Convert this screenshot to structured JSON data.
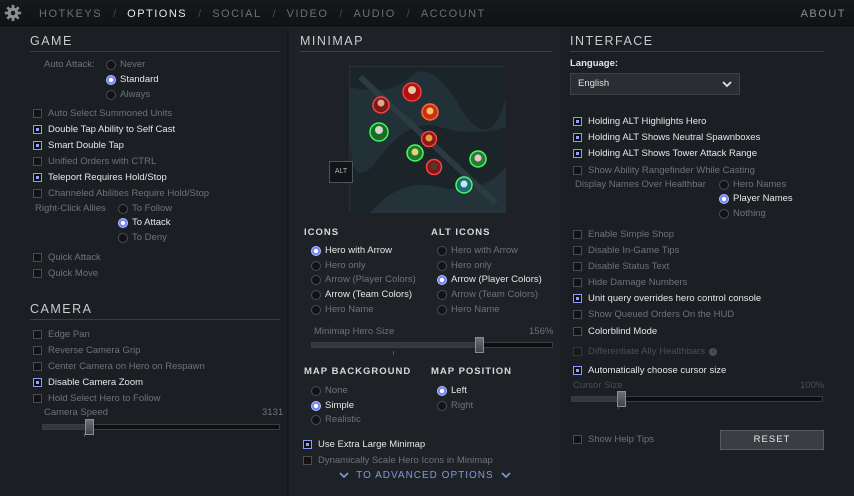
{
  "nav": {
    "tabs": [
      "HOTKEYS",
      "OPTIONS",
      "SOCIAL",
      "VIDEO",
      "AUDIO",
      "ACCOUNT"
    ],
    "active": "OPTIONS",
    "about": "ABOUT"
  },
  "game": {
    "title": "GAME",
    "auto_attack_label": "Auto Attack:",
    "auto_attack_options": [
      "Never",
      "Standard",
      "Always"
    ],
    "auto_attack_selected": "Standard",
    "checkboxes": [
      {
        "label": "Auto Select Summoned Units",
        "checked": false
      },
      {
        "label": "Double Tap Ability to Self Cast",
        "checked": true
      },
      {
        "label": "Smart Double Tap",
        "checked": true
      },
      {
        "label": "Unified Orders with CTRL",
        "checked": false
      },
      {
        "label": "Teleport Requires Hold/Stop",
        "checked": true
      },
      {
        "label": "Channeled Abilities Require Hold/Stop",
        "checked": false
      }
    ],
    "right_click_label": "Right-Click Allies",
    "right_click_options": [
      "To Follow",
      "To Attack",
      "To Deny"
    ],
    "right_click_selected": "To Attack",
    "quick_attack": "Quick Attack",
    "quick_move": "Quick Move"
  },
  "camera": {
    "title": "CAMERA",
    "checkboxes": [
      {
        "label": "Edge Pan",
        "checked": false
      },
      {
        "label": "Reverse Camera Grip",
        "checked": false
      },
      {
        "label": "Center Camera on Hero on Respawn",
        "checked": false
      },
      {
        "label": "Disable Camera Zoom",
        "checked": true
      },
      {
        "label": "Hold Select Hero to Follow",
        "checked": false
      }
    ],
    "speed_label": "Camera Speed",
    "speed_value": "3131",
    "speed_fraction": 0.2
  },
  "minimap": {
    "title": "MINIMAP",
    "alt_key": "ALT",
    "icons_title": "ICONS",
    "icons_options": [
      "Hero with Arrow",
      "Hero only",
      "Arrow (Player Colors)",
      "Arrow (Team Colors)",
      "Hero Name"
    ],
    "icons_selected": "Hero with Arrow",
    "alt_icons_title": "ALT ICONS",
    "alt_icons_options": [
      "Hero with Arrow",
      "Hero only",
      "Arrow (Player Colors)",
      "Arrow (Team Colors)",
      "Hero Name"
    ],
    "alt_icons_selected": "Arrow (Player Colors)",
    "hero_size_label": "Minimap Hero Size",
    "hero_size_value": "156%",
    "hero_size_fraction": 0.7,
    "bg_title": "MAP BACKGROUND",
    "bg_options": [
      "None",
      "Simple",
      "Realistic"
    ],
    "bg_selected": "Simple",
    "pos_title": "MAP POSITION",
    "pos_options": [
      "Left",
      "Right"
    ],
    "pos_selected": "Left",
    "extra_large": "Use Extra Large Minimap",
    "dyn_scale": "Dynamically Scale Hero Icons in Minimap",
    "advanced": "TO ADVANCED OPTIONS"
  },
  "interface": {
    "title": "INTERFACE",
    "language_label": "Language:",
    "language_value": "English",
    "checkboxes_a": [
      {
        "label": "Holding ALT Highlights Hero",
        "checked": true
      },
      {
        "label": "Holding ALT Shows Neutral Spawnboxes",
        "checked": true
      },
      {
        "label": "Holding ALT Shows Tower Attack Range",
        "checked": true
      },
      {
        "label": "Show Ability Rangefinder While Casting",
        "checked": false
      }
    ],
    "display_names_label": "Display Names Over Healthbar",
    "display_names_options": [
      "Hero Names",
      "Player Names",
      "Nothing"
    ],
    "display_names_selected": "Player Names",
    "checkboxes_b": [
      {
        "label": "Enable Simple Shop",
        "checked": false
      },
      {
        "label": "Disable In-Game Tips",
        "checked": false
      },
      {
        "label": "Disable Status Text",
        "checked": false
      },
      {
        "label": "Hide Damage Numbers",
        "checked": false
      },
      {
        "label": "Unit query overrides hero control console",
        "checked": true
      },
      {
        "label": "Show Queued Orders On the HUD",
        "checked": false
      },
      {
        "label": "Colorblind Mode",
        "checked": false
      },
      {
        "label": "Differentiate Ally Healthbars",
        "checked": false,
        "disabled": true
      },
      {
        "label": "Automatically choose cursor size",
        "checked": true
      }
    ],
    "cursor_label": "Cursor Size",
    "cursor_value": "100%",
    "cursor_fraction": 0.2,
    "help_tips": "Show Help Tips",
    "reset": "RESET"
  }
}
